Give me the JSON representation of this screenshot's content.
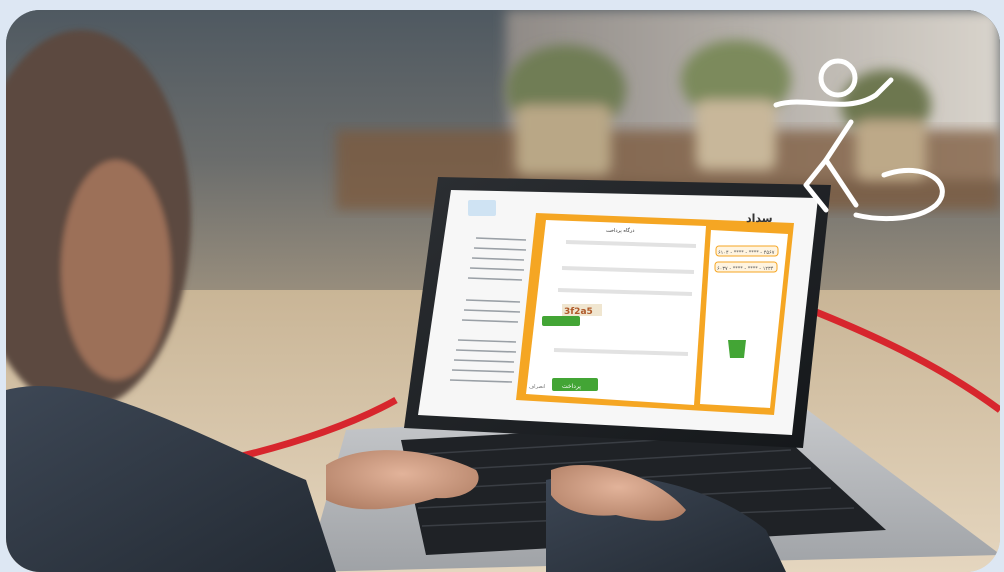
{
  "scene": {
    "description_kind": "photo",
    "colors": {
      "frame_bg": "#dde7f3",
      "accent_orange": "#f5a623",
      "accent_red": "#d7262d",
      "pay_green": "#43a535",
      "screen_bg": "#f7f7f7"
    },
    "icons": [
      "person-running-line-icon"
    ]
  },
  "screen": {
    "brand_logo": "سداد",
    "gateway_title": "درگاه پرداخت",
    "captcha_code": "3f2a5",
    "pay_button_label": "پرداخت",
    "cancel_label": "انصراف",
    "card_masked_1": "۶۱۰۴ - **** - **** - ۴۵۶۷",
    "card_masked_2": "۶۰۳۷ - **** - **** - ۱۲۳۴"
  }
}
